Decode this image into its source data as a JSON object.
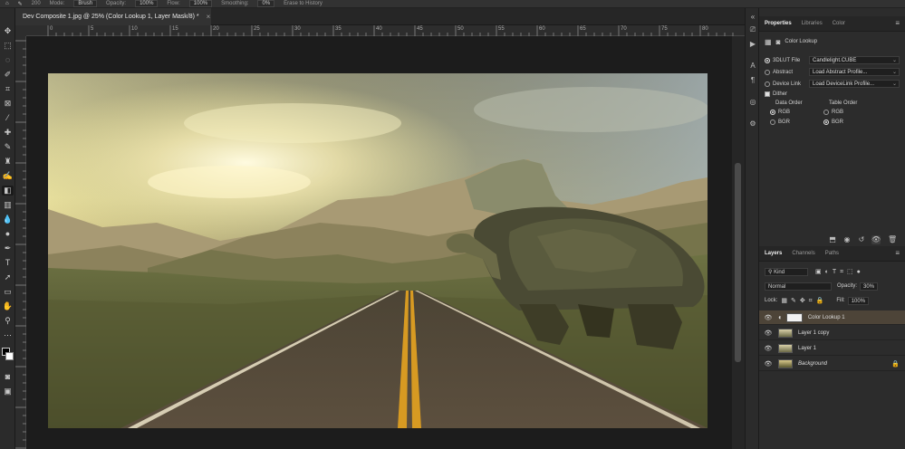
{
  "options_bar": {
    "mode_label": "Mode:",
    "mode_value": "Brush",
    "opacity_label": "Opacity:",
    "opacity_value": "100%",
    "flow_label": "Flow:",
    "flow_value": "100%",
    "smoothing_label": "Smoothing:",
    "smoothing_value": "0%",
    "erase_history": "Erase to History",
    "brush_size": "200"
  },
  "document": {
    "tab_title": "Dev Composite 1.jpg @ 25% (Color Lookup 1, Layer Mask/8) *",
    "close": "×"
  },
  "ruler": {
    "h_ticks": [
      "0",
      "5",
      "10",
      "15",
      "20",
      "25",
      "30",
      "35",
      "40",
      "45",
      "50",
      "55",
      "60",
      "65",
      "70",
      "75",
      "80"
    ]
  },
  "panels": {
    "tabs": [
      "Properties",
      "Libraries",
      "Color"
    ],
    "active_tab": "Properties",
    "properties": {
      "adjustment_title": "Color Lookup",
      "lut_file_label": "3DLUT File",
      "lut_file_value": "Candlelight.CUBE",
      "abstract_label": "Abstract",
      "abstract_value": "Load Abstract Profile...",
      "device_link_label": "Device Link",
      "device_link_value": "Load DeviceLink Profile...",
      "dither_label": "Dither",
      "data_order_label": "Data Order",
      "table_order_label": "Table Order",
      "data_order_options": [
        "RGB",
        "BGR"
      ],
      "data_order_selected": "RGB",
      "table_order_options": [
        "RGB",
        "BGR"
      ],
      "table_order_selected": "BGR"
    },
    "layers_tabs": [
      "Layers",
      "Channels",
      "Paths"
    ],
    "active_layers_tab": "Layers",
    "layers": {
      "filter_kind": "Kind",
      "blend_mode": "Normal",
      "opacity_label": "Opacity:",
      "opacity_value": "30%",
      "lock_label": "Lock:",
      "fill_label": "Fill:",
      "fill_value": "100%",
      "items": [
        {
          "name": "Color Lookup 1",
          "active": true
        },
        {
          "name": "Layer 1 copy",
          "active": false
        },
        {
          "name": "Layer 1",
          "active": false
        },
        {
          "name": "Background",
          "active": false
        }
      ]
    }
  },
  "colors": {
    "accent_active_layer": "#4d4438",
    "panel_bg": "#2c2c2c",
    "workspace_bg": "#1c1c1c"
  }
}
